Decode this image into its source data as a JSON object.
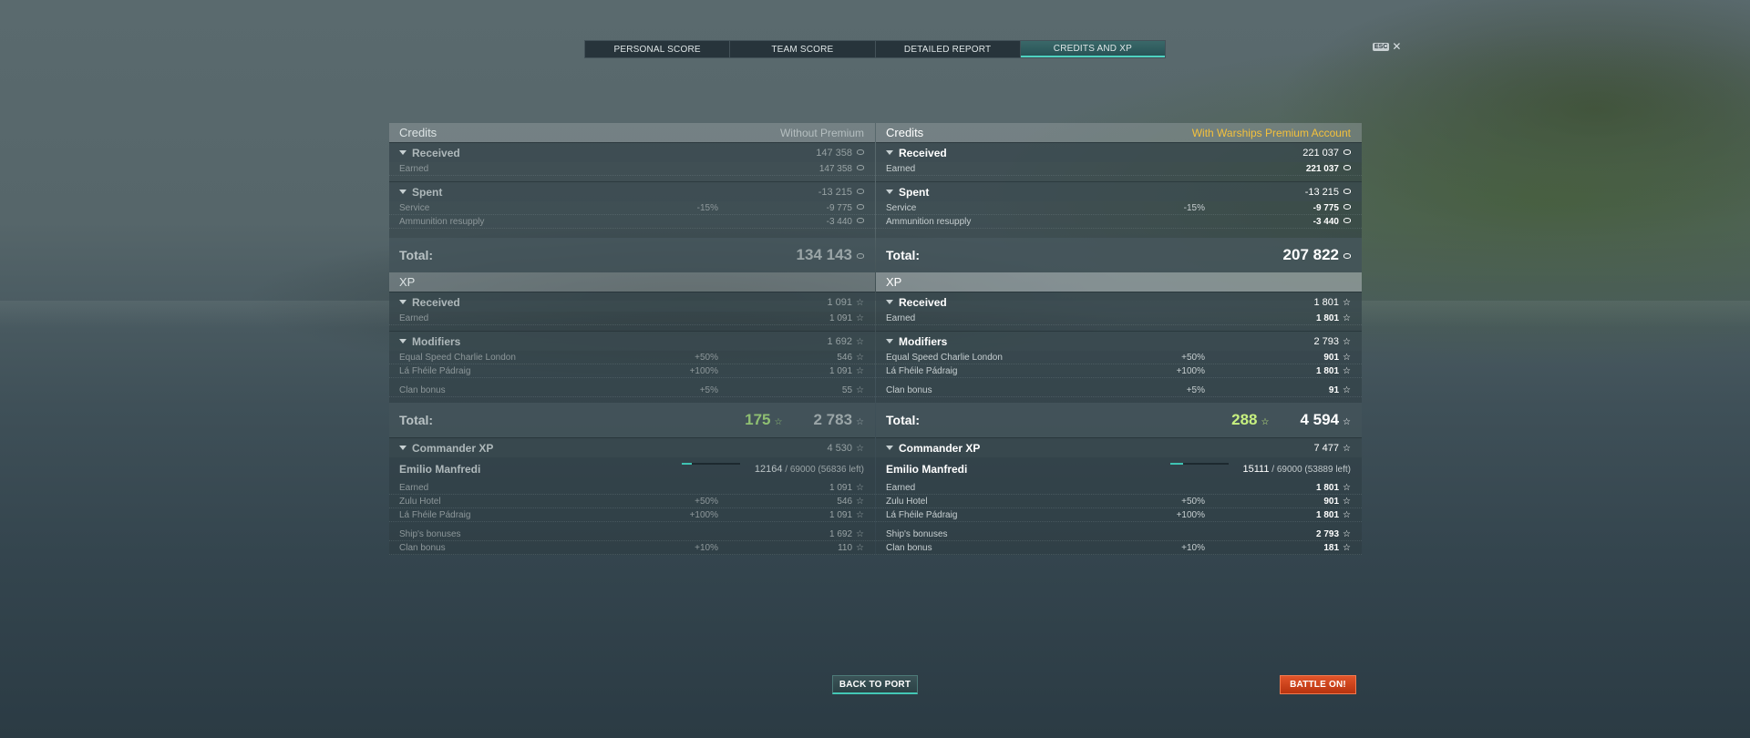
{
  "tabs": [
    {
      "label": "PERSONAL SCORE"
    },
    {
      "label": "TEAM SCORE"
    },
    {
      "label": "DETAILED REPORT"
    },
    {
      "label": "CREDITS AND XP",
      "active": true
    }
  ],
  "esc_label": "ESC",
  "close_glyph": "✕",
  "left": {
    "credits": {
      "title": "Credits",
      "subtitle": "Without Premium",
      "received": {
        "label": "Received",
        "value": "147 358"
      },
      "earned": {
        "label": "Earned",
        "value": "147 358"
      },
      "spent": {
        "label": "Spent",
        "value": "-13 215"
      },
      "service": {
        "label": "Service",
        "pct": "-15%",
        "value": "-9 775"
      },
      "ammo": {
        "label": "Ammunition resupply",
        "value": "-3 440"
      },
      "total": {
        "label": "Total:",
        "value": "134 143"
      }
    },
    "xp": {
      "title": "XP",
      "received": {
        "label": "Received",
        "value": "1 091"
      },
      "earned": {
        "label": "Earned",
        "value": "1 091"
      },
      "modifiers": {
        "label": "Modifiers",
        "value": "1 692"
      },
      "mod1": {
        "label": "Equal Speed Charlie London",
        "pct": "+50%",
        "value": "546"
      },
      "mod2": {
        "label": "Lá Fhéile Pádraig",
        "pct": "+100%",
        "value": "1 091"
      },
      "clan": {
        "label": "Clan bonus",
        "pct": "+5%",
        "value": "55"
      },
      "total": {
        "label": "Total:",
        "free": "175",
        "value": "2 783"
      }
    },
    "commander": {
      "label": "Commander XP",
      "value": "4 530",
      "name": "Emilio Manfredi",
      "current": "12164",
      "rest": "/ 69000 (56836 left)",
      "progress": 0.176,
      "earned": {
        "label": "Earned",
        "value": "1 091"
      },
      "flag1": {
        "label": "Zulu Hotel",
        "pct": "+50%",
        "value": "546"
      },
      "flag2": {
        "label": "Lá Fhéile Pádraig",
        "pct": "+100%",
        "value": "1 091"
      },
      "ship": {
        "label": "Ship's bonuses",
        "value": "1 692"
      },
      "clan": {
        "label": "Clan bonus",
        "pct": "+10%",
        "value": "110"
      }
    }
  },
  "right": {
    "credits": {
      "title": "Credits",
      "subtitle": "With Warships Premium Account",
      "received": {
        "label": "Received",
        "value": "221 037"
      },
      "earned": {
        "label": "Earned",
        "value": "221 037"
      },
      "spent": {
        "label": "Spent",
        "value": "-13 215"
      },
      "service": {
        "label": "Service",
        "pct": "-15%",
        "value": "-9 775"
      },
      "ammo": {
        "label": "Ammunition resupply",
        "value": "-3 440"
      },
      "total": {
        "label": "Total:",
        "value": "207 822"
      }
    },
    "xp": {
      "title": "XP",
      "received": {
        "label": "Received",
        "value": "1 801"
      },
      "earned": {
        "label": "Earned",
        "value": "1 801"
      },
      "modifiers": {
        "label": "Modifiers",
        "value": "2 793"
      },
      "mod1": {
        "label": "Equal Speed Charlie London",
        "pct": "+50%",
        "value": "901"
      },
      "mod2": {
        "label": "Lá Fhéile Pádraig",
        "pct": "+100%",
        "value": "1 801"
      },
      "clan": {
        "label": "Clan bonus",
        "pct": "+5%",
        "value": "91"
      },
      "total": {
        "label": "Total:",
        "free": "288",
        "value": "4 594"
      }
    },
    "commander": {
      "label": "Commander XP",
      "value": "7 477",
      "name": "Emilio Manfredi",
      "current": "15111",
      "rest": "/ 69000 (53889 left)",
      "progress": 0.219,
      "earned": {
        "label": "Earned",
        "value": "1 801"
      },
      "flag1": {
        "label": "Zulu Hotel",
        "pct": "+50%",
        "value": "901"
      },
      "flag2": {
        "label": "Lá Fhéile Pádraig",
        "pct": "+100%",
        "value": "1 801"
      },
      "ship": {
        "label": "Ship's bonuses",
        "value": "2 793"
      },
      "clan": {
        "label": "Clan bonus",
        "pct": "+10%",
        "value": "181"
      }
    }
  },
  "buttons": {
    "back": "BACK TO PORT",
    "battle": "BATTLE ON!"
  },
  "icons": {
    "credit": "coin-icon",
    "xp": "star-icon"
  }
}
